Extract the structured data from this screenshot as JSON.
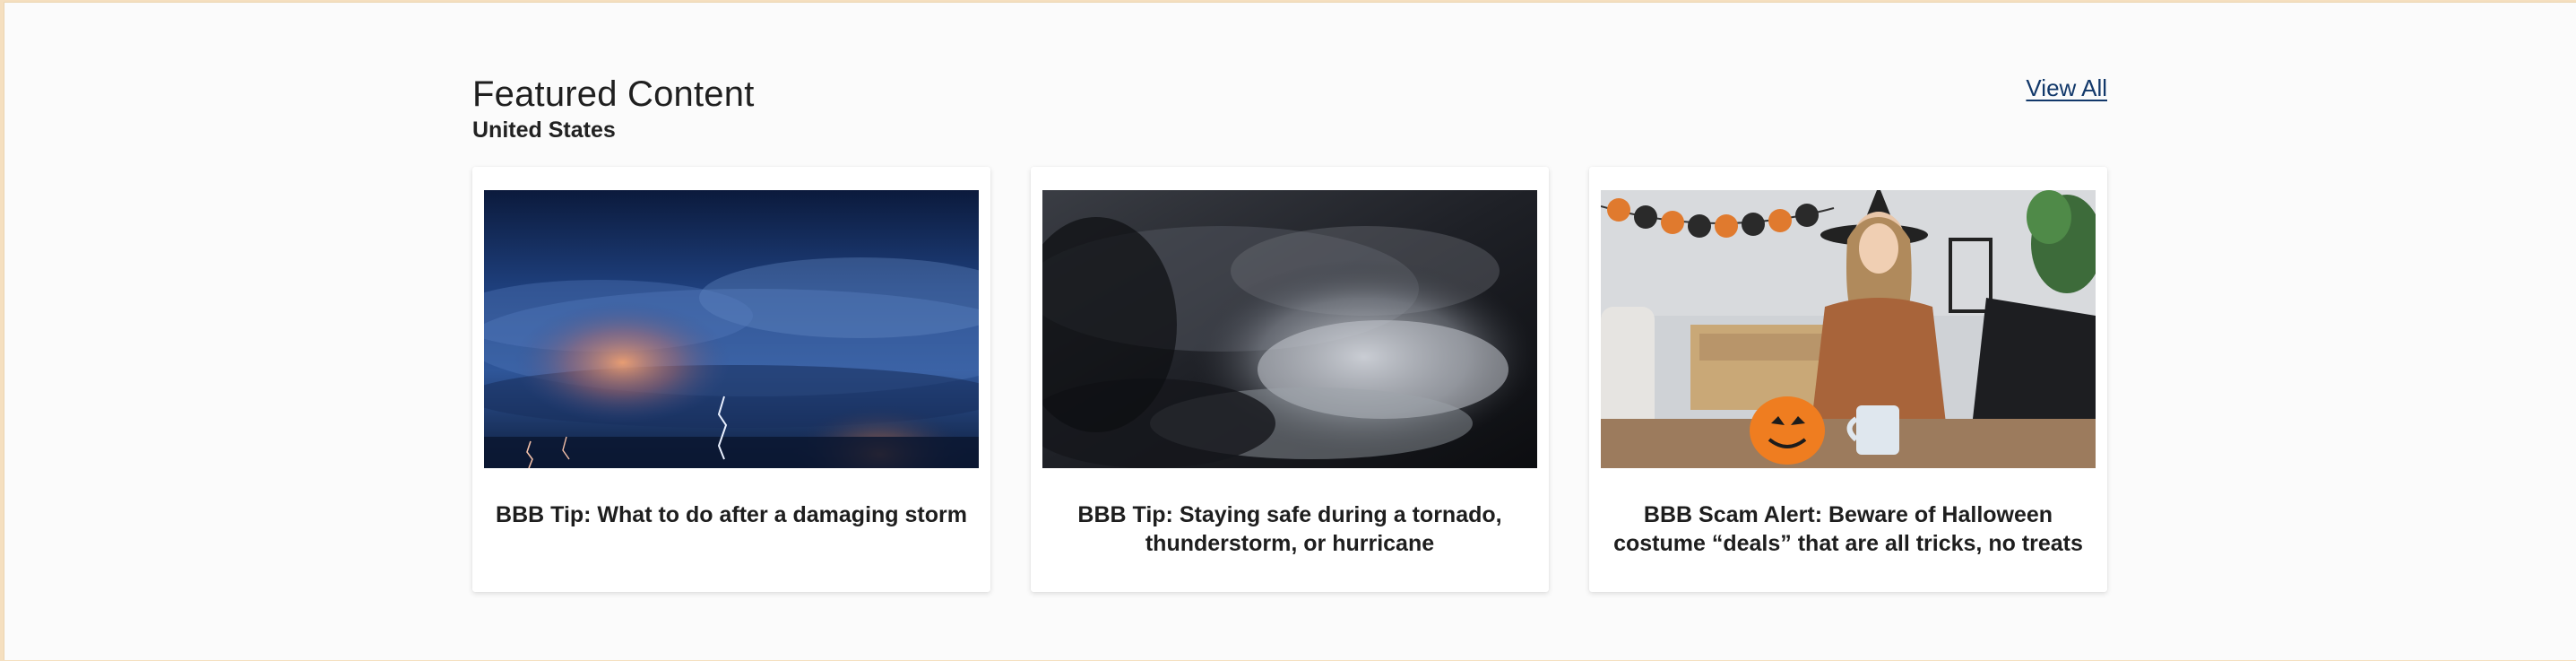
{
  "section": {
    "title": "Featured Content",
    "subtitle": "United States",
    "view_all_label": "View All"
  },
  "cards": [
    {
      "title": "BBB Tip: What to do after a damaging storm",
      "image": "storm-lightning-image"
    },
    {
      "title": "BBB Tip: Staying safe during a tornado, thunderstorm, or hurricane",
      "image": "dark-storm-clouds-image"
    },
    {
      "title": "BBB Scam Alert: Beware of Halloween costume “deals” that are all tricks, no treats",
      "image": "halloween-shopping-image"
    }
  ],
  "colors": {
    "page_background": "#fbfbfb",
    "frame_accent": "#f5dfbf",
    "link": "#12386a",
    "text": "#1f1f1f"
  }
}
